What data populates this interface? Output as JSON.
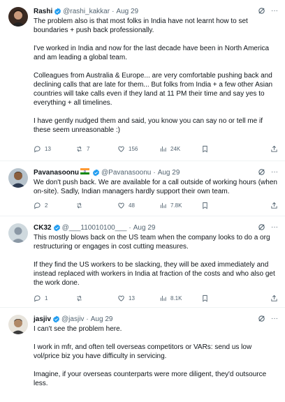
{
  "tweets": [
    {
      "name": "Rashi",
      "handle": "@rashi_kakkar",
      "time": "Aug 29",
      "paragraphs": [
        "The problem also is that most folks in India have not learnt how to set boundaries + push back professionally.",
        "I've worked in India and now for the last decade have been in North America and am leading a global team.",
        "Colleagues from Australia & Europe... are very comfortable pushing back and declining calls that are late for them... But folks from India + a few other Asian countries will take calls even if they land at 11 PM their time and say yes to everything + all timelines.",
        "I have gently nudged them and said, you know you can say no or tell me if these seem unreasonable :)"
      ],
      "replies": "13",
      "reposts": "7",
      "likes": "156",
      "views": "24K"
    },
    {
      "name": "Pavanasoonu",
      "handle": "@Pavanasoonu",
      "time": "Aug 29",
      "paragraphs": [
        "We don't push back.  We are available for a call outside of working hours (when on-site).  Sadly, Indian managers hardly support their own team."
      ],
      "replies": "2",
      "reposts": "",
      "likes": "48",
      "views": "7.8K"
    },
    {
      "name": "CK32",
      "handle": "@___110010100___",
      "time": "Aug 29",
      "paragraphs": [
        "This mostly blows back on the US team when the company looks to do a org restructuring or engages in cost cutting measures.",
        "If they find the US workers to be slacking, they will be axed immediately and instead replaced with workers in India at fraction of the costs and who also get the work done."
      ],
      "replies": "1",
      "reposts": "",
      "likes": "13",
      "views": "8.1K"
    },
    {
      "name": "jasjiv",
      "handle": "@jasjiv",
      "time": "Aug 29",
      "paragraphs": [
        "I can't see the problem here.",
        "I work in mfr, and often tell overseas competitors or VARs: send us low vol/price biz you have difficulty in servicing.",
        "Imagine, if your overseas counterparts were more diligent, they'd outsource less."
      ]
    }
  ],
  "colors": {
    "text": "#0f1419",
    "muted": "#536471",
    "verified": "#1d9bf0",
    "border": "#eff3f4"
  },
  "icons": [
    "verified-badge-icon",
    "grok-icon",
    "more-icon",
    "reply-icon",
    "repost-icon",
    "like-icon",
    "views-icon",
    "bookmark-icon",
    "share-icon",
    "india-flag-icon"
  ]
}
